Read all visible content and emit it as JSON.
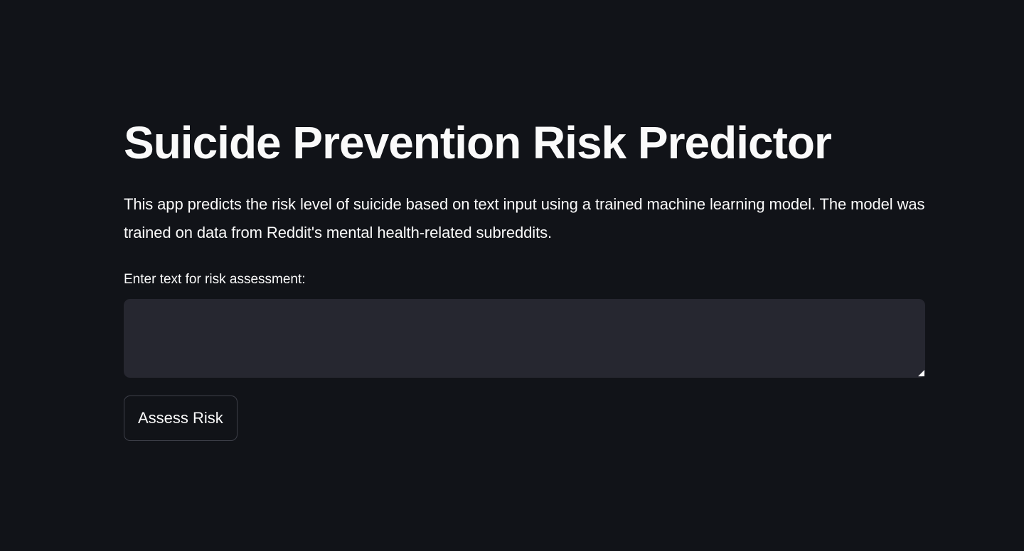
{
  "app": {
    "title": "Suicide Prevention Risk Predictor",
    "description": "This app predicts the risk level of suicide based on text input using a trained machine learning model. The model was trained on data from Reddit's mental health-related subreddits."
  },
  "form": {
    "text_label": "Enter text for risk assessment:",
    "text_value": "",
    "submit_label": "Assess Risk"
  },
  "colors": {
    "background": "#111318",
    "input_background": "#262730",
    "text": "#fafafa"
  }
}
